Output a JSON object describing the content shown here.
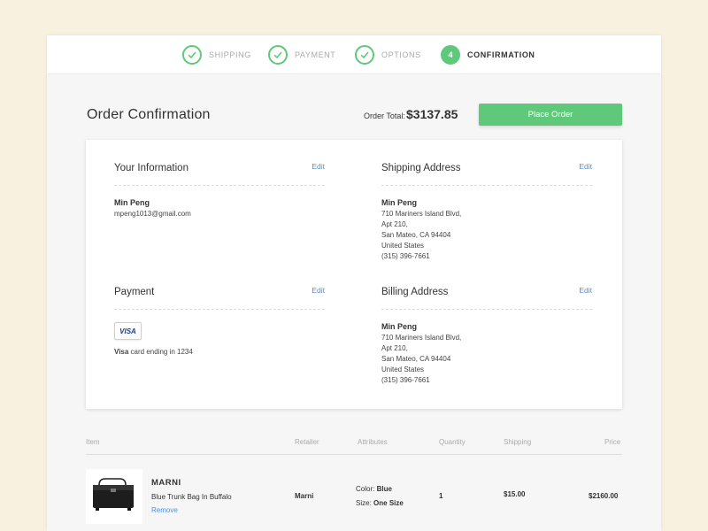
{
  "steps": [
    {
      "label": "SHIPPING",
      "state": "done"
    },
    {
      "label": "PAYMENT",
      "state": "done"
    },
    {
      "label": "OPTIONS",
      "state": "done"
    },
    {
      "label": "CONFIRMATION",
      "number": "4",
      "state": "active"
    }
  ],
  "header": {
    "title": "Order Confirmation",
    "total_label": "Order Total:",
    "total_value": "$3137.85",
    "place_order": "Place Order"
  },
  "your_info": {
    "heading": "Your Information",
    "edit": "Edit",
    "name": "Min Peng",
    "email": "mpeng1013@gmail.com"
  },
  "shipping_address": {
    "heading": "Shipping Address",
    "edit": "Edit",
    "name": "Min Peng",
    "lines": [
      "710 Mariners Island Blvd,",
      "Apt 210,",
      "San Mateo, CA 94404",
      "United States",
      "(315) 396-7661"
    ]
  },
  "payment": {
    "heading": "Payment",
    "edit": "Edit",
    "card_brand": "VISA",
    "card_type": "Visa",
    "card_text": " card ending in 1234"
  },
  "billing_address": {
    "heading": "Billing Address",
    "edit": "Edit",
    "name": "Min Peng",
    "lines": [
      "710 Mariners Island Blvd,",
      "Apt 210,",
      "San Mateo, CA 94404",
      "United States",
      "(315) 396-7661"
    ]
  },
  "table": {
    "headers": {
      "item": "Item",
      "retailer": "Retailer",
      "attributes": "Attributes",
      "quantity": "Quantity",
      "shipping": "Shipping",
      "price": "Price"
    },
    "rows": [
      {
        "brand": "MARNI",
        "product": "Blue Trunk Bag In Buffalo",
        "remove": "Remove",
        "retailer": "Marni",
        "color_label": "Color:",
        "color_value": "Blue",
        "size_label": "Size:",
        "size_value": "One Size",
        "quantity": "1",
        "shipping": "$15.00",
        "price": "$2160.00"
      }
    ]
  },
  "colors": {
    "accent": "#5fc87a",
    "link": "#4a90e2",
    "background": "#f8f1df"
  }
}
